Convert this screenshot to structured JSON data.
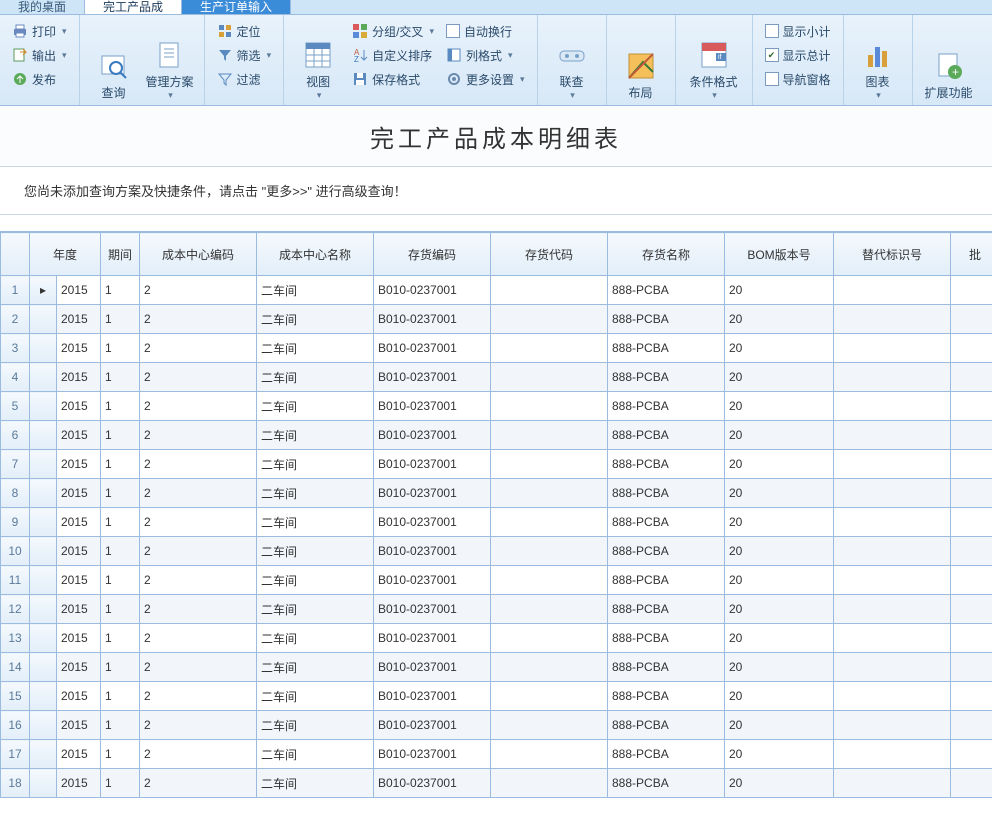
{
  "tabs": {
    "t0": "我的桌面",
    "t1": "完工产品成",
    "t2": "生产订单输入"
  },
  "ribbon": {
    "left": {
      "print": "打印",
      "export": "输出",
      "publish": "发布"
    },
    "query": {
      "search": "查询",
      "scheme": "管理方案"
    },
    "filter": {
      "locate": "定位",
      "filter": "筛选",
      "filter2": "过滤"
    },
    "view": {
      "view": "视图",
      "group": "分组/交叉",
      "sort": "自定义排序",
      "save": "保存格式",
      "autowrap": "自动换行",
      "colfmt": "列格式",
      "more": "更多设置"
    },
    "link": {
      "link": "联查"
    },
    "layout": {
      "layout": "布局"
    },
    "cond": {
      "cond": "条件格式"
    },
    "disp": {
      "subtotal": "显示小计",
      "total": "显示总计",
      "nav": "导航窗格"
    },
    "chart": {
      "chart": "图表"
    },
    "ext": {
      "ext": "扩展功能"
    }
  },
  "title": "完工产品成本明细表",
  "hint": "您尚未添加查询方案及快捷条件，请点击 \"更多>>\" 进行高级查询！",
  "cols": {
    "year": "年度",
    "period": "期间",
    "cccode": "成本中心编码",
    "ccname": "成本中心名称",
    "invcode": "存货编码",
    "invcode2": "存货代码",
    "invname": "存货名称",
    "bom": "BOM版本号",
    "sub": "替代标识号",
    "last": "批"
  },
  "row": {
    "year": "2015",
    "period": "1",
    "cccode": "2",
    "ccname": "二车间",
    "invcode": "B010-0237001",
    "invcode2": "",
    "invname": "888-PCBA",
    "bom": "20",
    "sub": ""
  },
  "rowcount": 18
}
